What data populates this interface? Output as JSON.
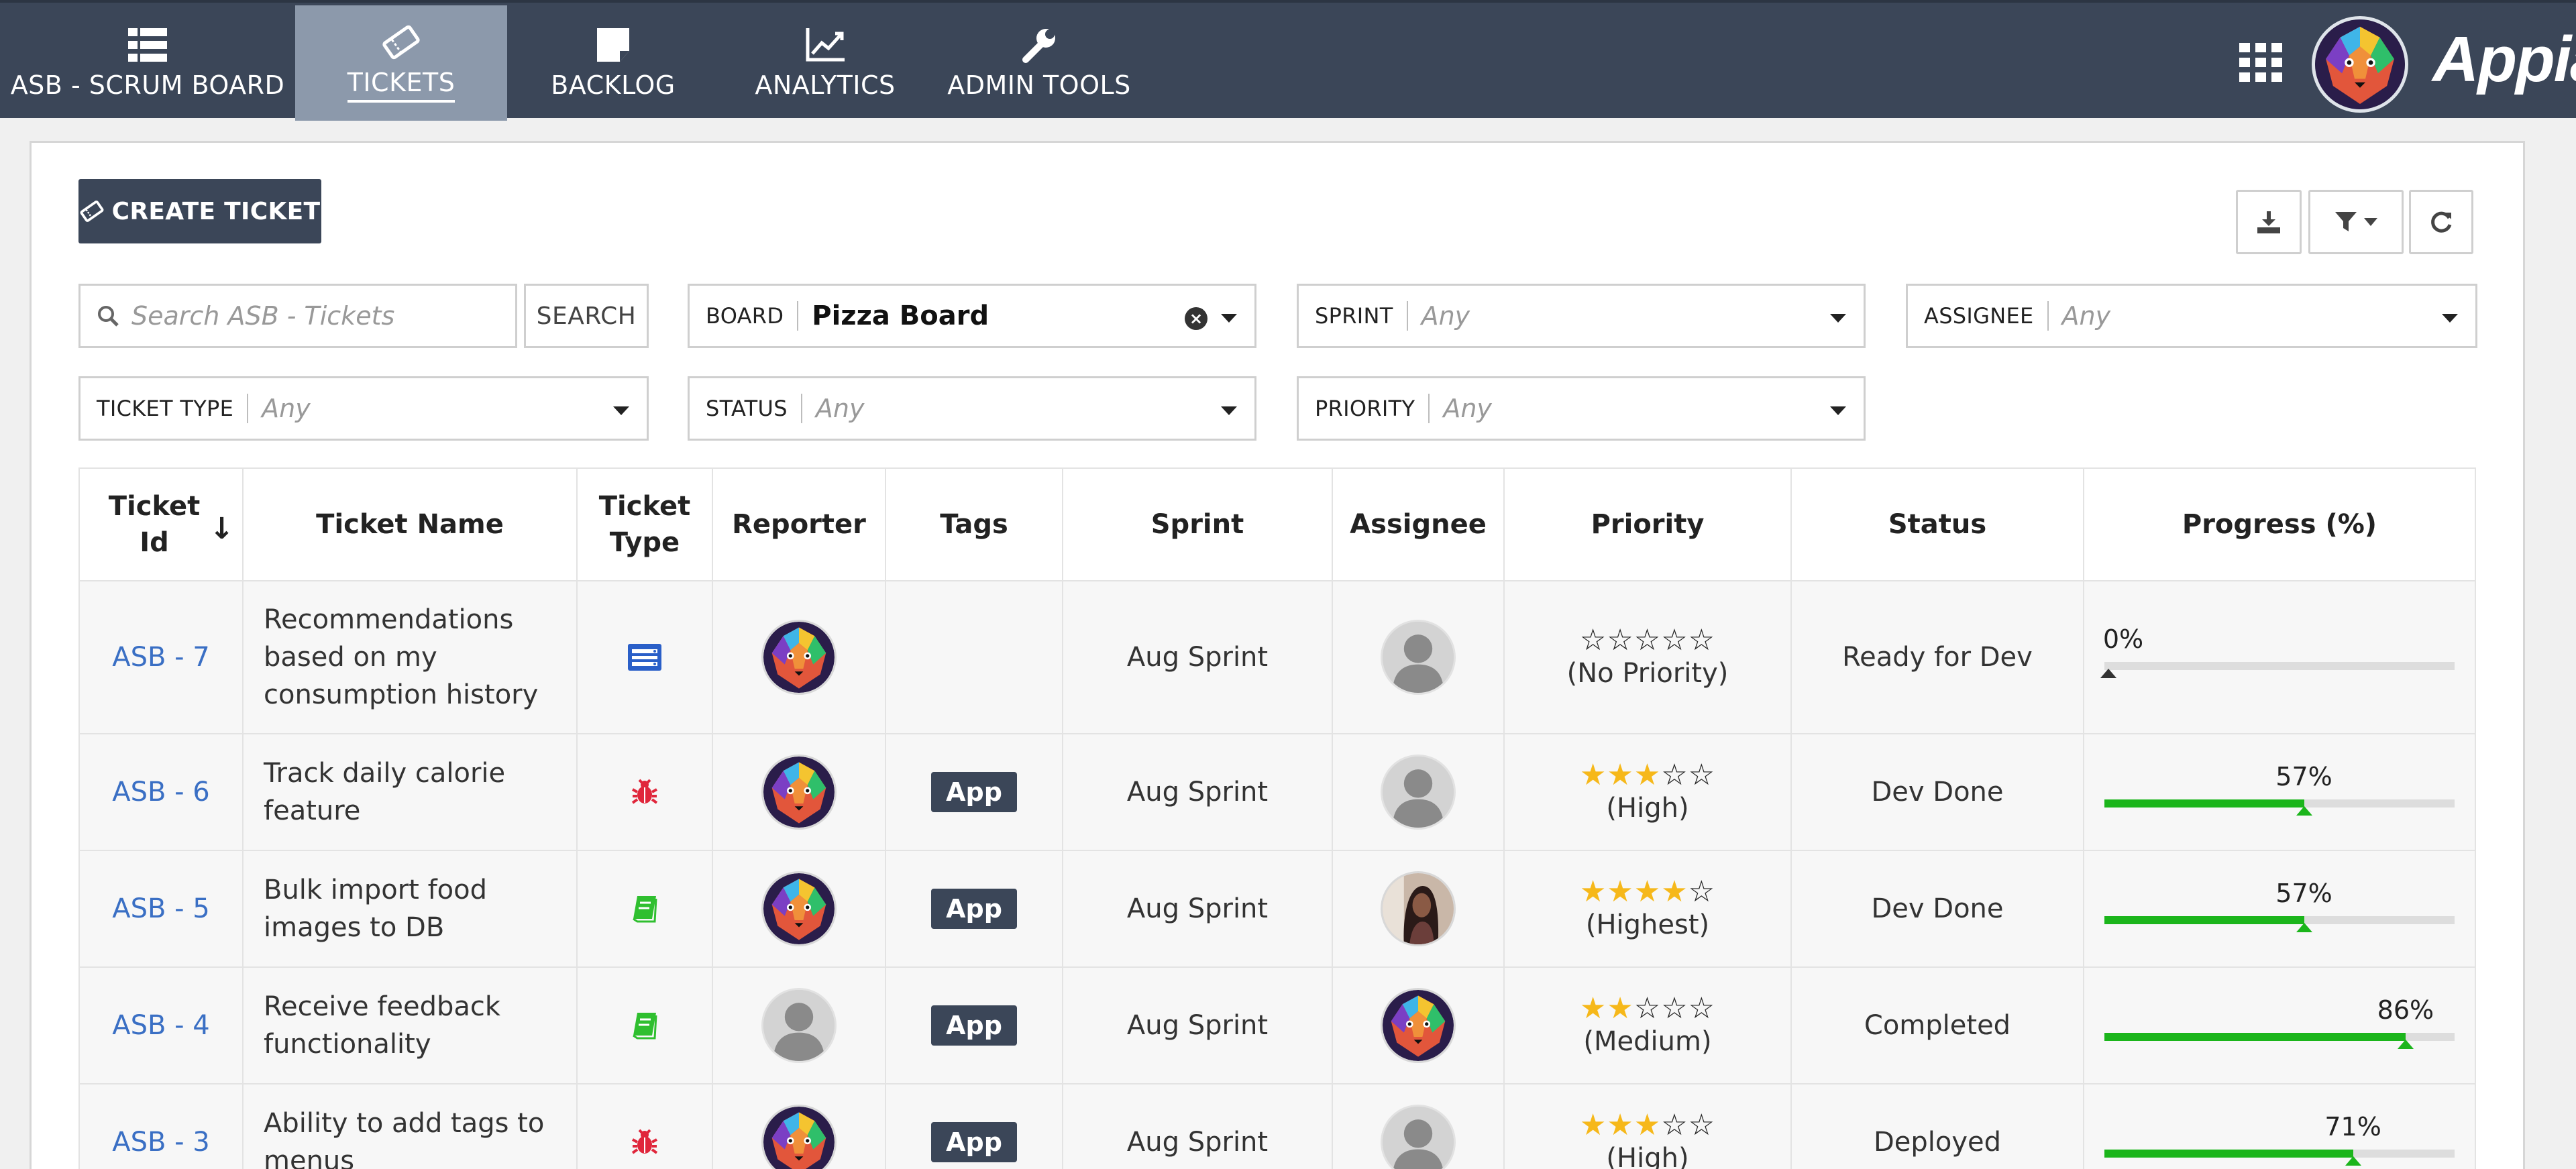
{
  "nav": {
    "tabs": [
      {
        "label": "ASB - SCRUM BOARD",
        "icon": "list-icon"
      },
      {
        "label": "TICKETS",
        "icon": "ticket-icon",
        "active": true
      },
      {
        "label": "BACKLOG",
        "icon": "note-icon"
      },
      {
        "label": "ANALYTICS",
        "icon": "chart-icon"
      },
      {
        "label": "ADMIN TOOLS",
        "icon": "wrench-icon"
      }
    ],
    "apps_icon": "grid-icon",
    "brand": "Appian"
  },
  "toolbar": {
    "create_label": "CREATE TICKET",
    "download_icon": "download-icon",
    "filter_icon": "filter-icon",
    "refresh_icon": "refresh-icon"
  },
  "search": {
    "placeholder": "Search ASB - Tickets",
    "button_label": "SEARCH"
  },
  "filters": {
    "board": {
      "label": "BOARD",
      "value": "Pizza Board"
    },
    "sprint": {
      "label": "SPRINT",
      "value": "Any"
    },
    "assignee": {
      "label": "ASSIGNEE",
      "value": "Any"
    },
    "ticket_type": {
      "label": "TICKET TYPE",
      "value": "Any"
    },
    "status": {
      "label": "STATUS",
      "value": "Any"
    },
    "priority": {
      "label": "PRIORITY",
      "value": "Any"
    }
  },
  "table": {
    "headers": {
      "ticket_id_1": "Ticket",
      "ticket_id_2": "Id",
      "sort_arrow": "↓",
      "ticket_name": "Ticket Name",
      "ticket_type_1": "Ticket",
      "ticket_type_2": "Type",
      "reporter": "Reporter",
      "tags": "Tags",
      "sprint": "Sprint",
      "assignee": "Assignee",
      "priority": "Priority",
      "status": "Status",
      "progress": "Progress (%)"
    },
    "rows": [
      {
        "id": "ASB - 7",
        "name_lines": [
          "Recommendations",
          "based on my",
          "consumption history"
        ],
        "type": "story-icon",
        "reporter": "lion",
        "tag": "",
        "sprint": "Aug Sprint",
        "assignee": "ghost",
        "stars": 0,
        "priority": "(No Priority)",
        "status": "Ready for Dev",
        "progress": 0,
        "progress_label": "0%"
      },
      {
        "id": "ASB - 6",
        "name_lines": [
          "Track daily calorie",
          "feature"
        ],
        "type": "bug-icon",
        "reporter": "lion",
        "tag": "App",
        "sprint": "Aug Sprint",
        "assignee": "ghost",
        "stars": 3,
        "priority": "(High)",
        "status": "Dev Done",
        "progress": 57,
        "progress_label": "57%"
      },
      {
        "id": "ASB - 5",
        "name_lines": [
          "Bulk import food",
          "images to DB"
        ],
        "type": "book-icon",
        "reporter": "lion",
        "tag": "App",
        "sprint": "Aug Sprint",
        "assignee": "photo",
        "stars": 4,
        "priority": "(Highest)",
        "status": "Dev Done",
        "progress": 57,
        "progress_label": "57%"
      },
      {
        "id": "ASB - 4",
        "name_lines": [
          "Receive feedback",
          "functionality"
        ],
        "type": "book-icon",
        "reporter": "ghost",
        "tag": "App",
        "sprint": "Aug Sprint",
        "assignee": "lion",
        "stars": 2,
        "priority": "(Medium)",
        "status": "Completed",
        "progress": 86,
        "progress_label": "86%"
      },
      {
        "id": "ASB - 3",
        "name_lines": [
          "Ability to add tags to",
          "menus"
        ],
        "type": "bug-icon",
        "reporter": "lion",
        "tag": "App",
        "sprint": "Aug Sprint",
        "assignee": "ghost",
        "stars": 3,
        "priority": "(High)",
        "status": "Deployed",
        "progress": 71,
        "progress_label": "71%"
      }
    ]
  },
  "colors": {
    "nav_bg": "#3b4658",
    "nav_active": "#8c99ab",
    "link": "#3a6fc4",
    "progress": "#1bb51b",
    "star": "#f6b81a",
    "bug": "#e0263b",
    "story": "#2a5fc8",
    "book": "#2fbf2f"
  }
}
